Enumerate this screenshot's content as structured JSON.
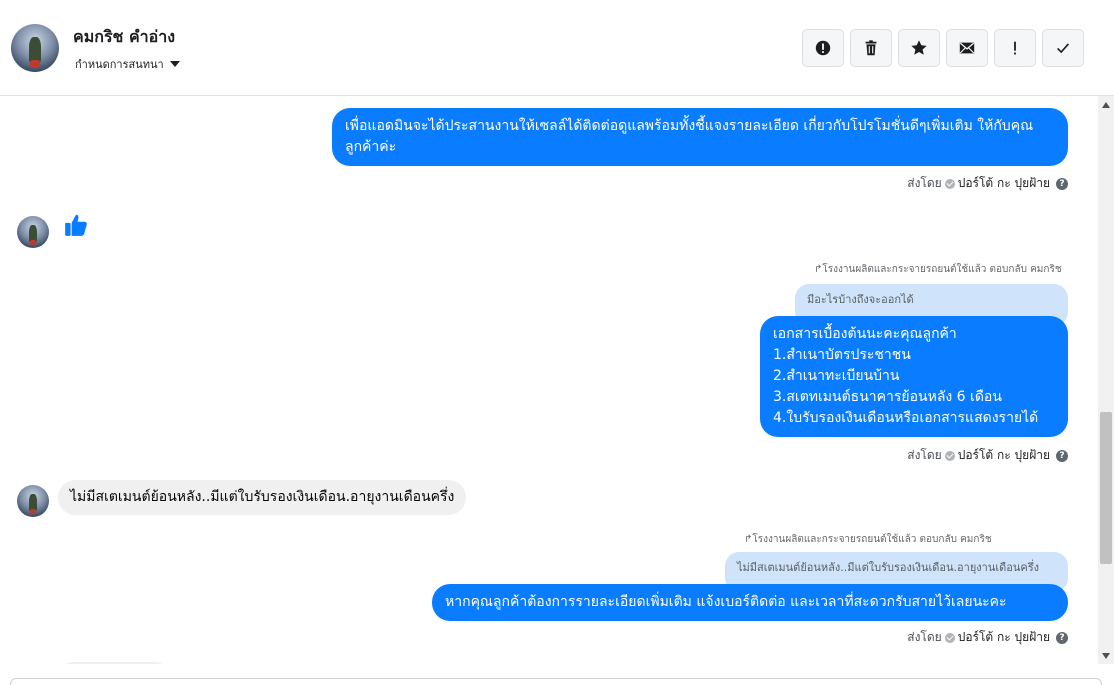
{
  "header": {
    "contact_name": "คมกริช คำอ่าง",
    "conversation_settings": "กำหนดการสนทนา",
    "actions": [
      {
        "icon": "alert-circle-icon",
        "label": "spam"
      },
      {
        "icon": "trash-icon",
        "label": "delete"
      },
      {
        "icon": "star-icon",
        "label": "star"
      },
      {
        "icon": "envelope-icon",
        "label": "mark-unread"
      },
      {
        "icon": "exclamation-icon",
        "label": "follow-up"
      },
      {
        "icon": "checkmark-icon",
        "label": "done"
      }
    ]
  },
  "thread": {
    "msg1": {
      "text": "เพื่อแอดมินจะได้ประสานงานให้เซลล์ได้ติดต่อดูแลพร้อมทั้งชี้แจงรายละเอียด เกี่ยวกับโปรโมชั่นดีๆเพิ่มเติม ให้กับคุณลูกค้าค่ะ",
      "sent_prefix": "ส่งโดย",
      "sender": "ปอร์โต้ กะ ปุยฝ้าย"
    },
    "like": {
      "icon": "thumbs-up-icon"
    },
    "msg2": {
      "reply_meta": "โรงงานผลิตและกระจายรถยนต์ใช้แล้ว ตอบกลับ คมกริช",
      "quote": "มีอะไรบ้างถึงจะออกได้",
      "lines": [
        "เอกสารเบื้องต้นนะคะคุณลูกค้า",
        "1.สำเนาบัตรประชาชน",
        "2.สำเนาทะเบียนบ้าน",
        "3.สเตทเมนต์ธนาคารย้อนหลัง 6 เดือน",
        "4.ใบรับรองเงินเดือนหรือเอกสารแสดงรายได้"
      ],
      "sent_prefix": "ส่งโดย",
      "sender": "ปอร์โต้ กะ ปุยฝ้าย"
    },
    "msg3": {
      "text": "ไม่มีสเตเมนต์ย้อนหลัง..มีแต่ใบรับรองเงินเดือน.อายุงานเดือนครึ่ง"
    },
    "msg4": {
      "reply_meta": "โรงงานผลิตและกระจายรถยนต์ใช้แล้ว ตอบกลับ คมกริช",
      "quote": "ไม่มีสเตเมนต์ย้อนหลัง..มีแต่ใบรับรองเงินเดือน.อายุงานเดือนครึ่ง",
      "text": "หากคุณลูกค้าต้องการรายละเอียดเพิ่มเติม แจ้งเบอร์ติดต่อ และเวลาที่สะดวกรับสายไว้เลยนะคะ",
      "sent_prefix": "ส่งโดย",
      "sender": "ปอร์โต้ กะ ปุยฝ้าย"
    }
  },
  "colors": {
    "outgoing_bubble": "#0a7cff",
    "incoming_bubble": "#f0f0f0",
    "quote_bubble": "#cfe4fb"
  }
}
